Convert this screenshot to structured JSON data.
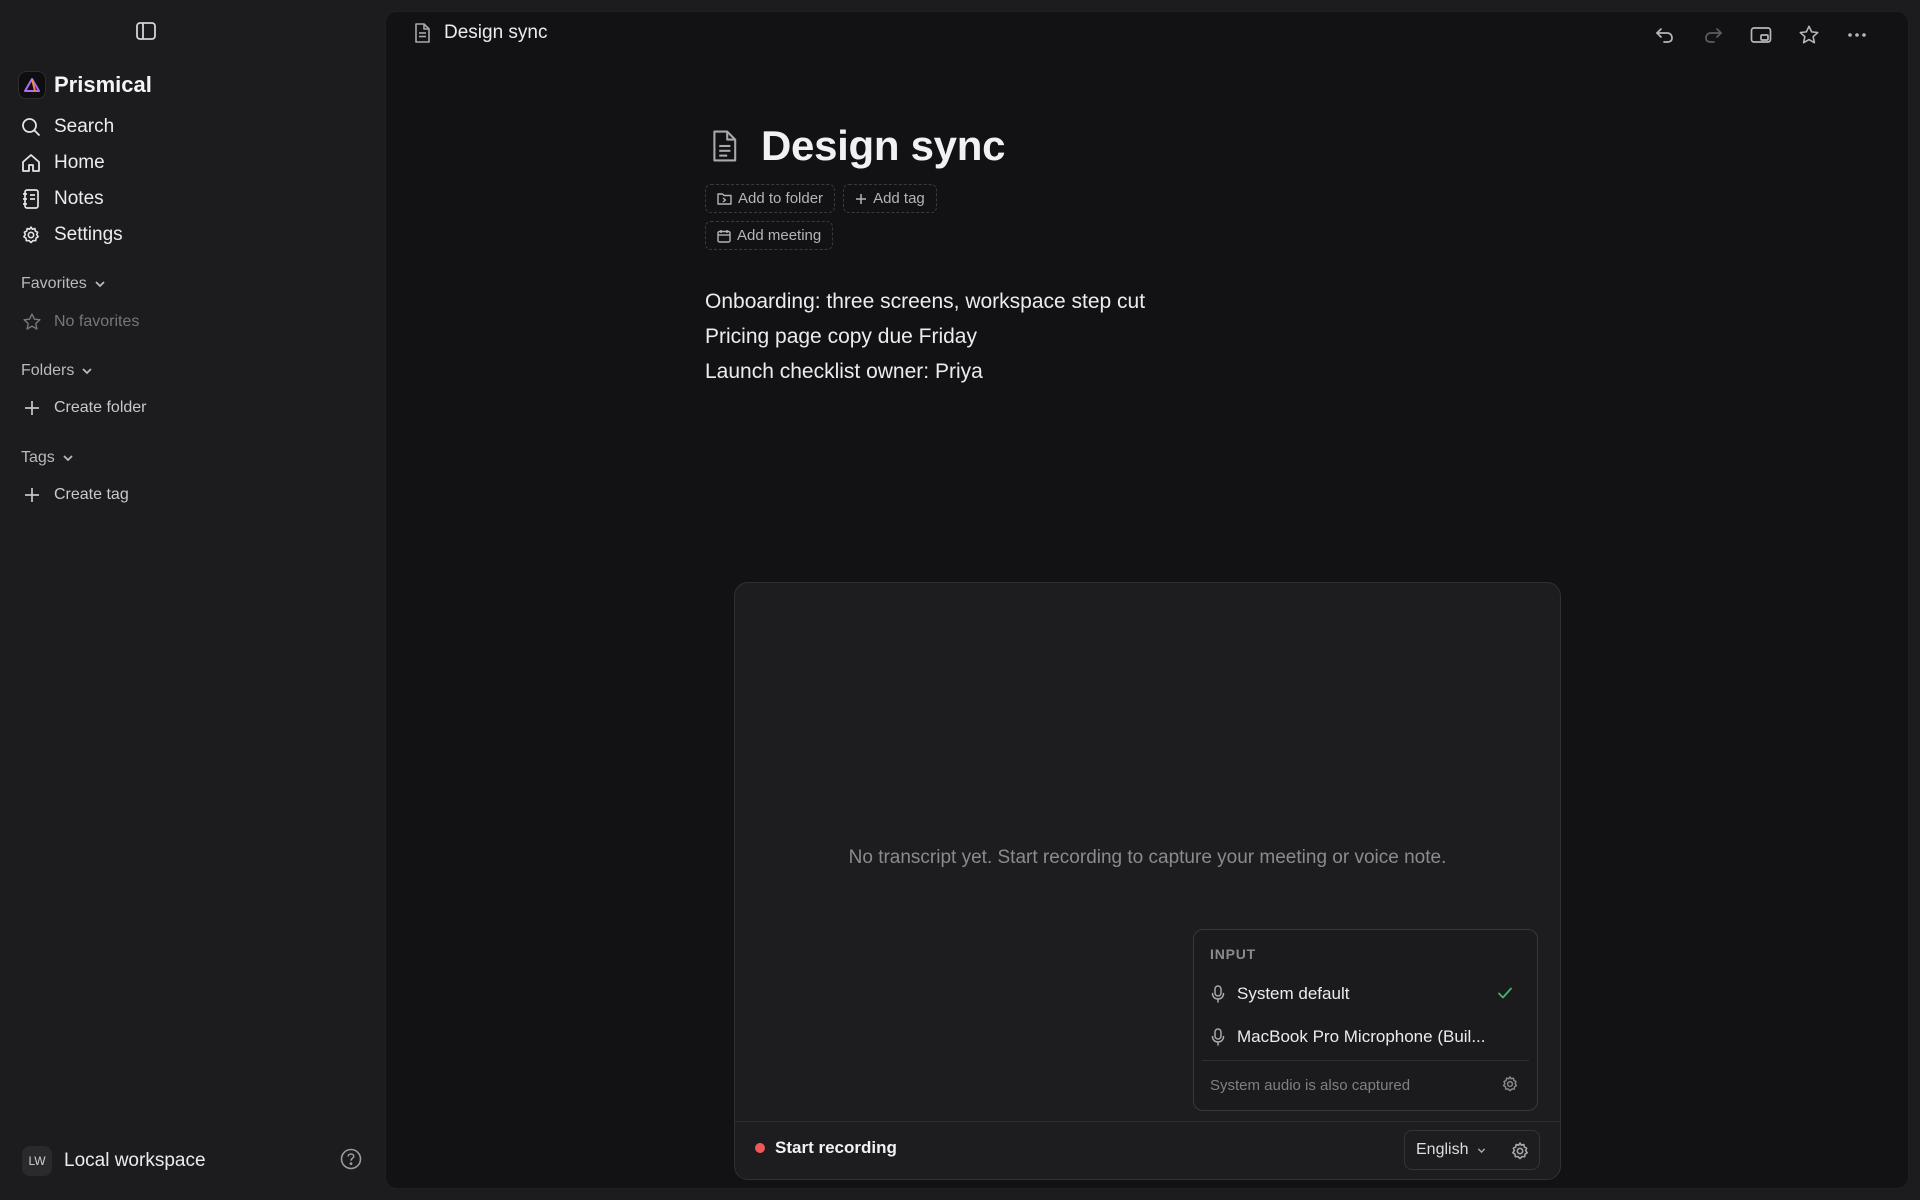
{
  "sidebar": {
    "toggle_icon": "sidebar-toggle-icon",
    "brand": {
      "name": "Prismical",
      "logo_icon": "prism-logo-icon",
      "logo_color": "#b06cf7"
    },
    "nav": [
      {
        "label": "Search",
        "icon": "search-icon"
      },
      {
        "label": "Home",
        "icon": "home-icon"
      },
      {
        "label": "Notes",
        "icon": "notes-icon"
      },
      {
        "label": "Settings",
        "icon": "gear-icon"
      }
    ],
    "favorites": {
      "label": "Favorites",
      "empty": "No favorites"
    },
    "folders": {
      "label": "Folders",
      "create": "Create folder"
    },
    "tags": {
      "label": "Tags",
      "create": "Create tag"
    },
    "workspace": {
      "initials": "LW",
      "name": "Local workspace"
    }
  },
  "topbar": {
    "title": "Design sync",
    "actions": [
      "undo-icon",
      "redo-icon",
      "present-icon",
      "star-icon",
      "more-icon"
    ]
  },
  "document": {
    "title": "Design sync",
    "chips": {
      "folder": "Add to folder",
      "tag": "Add tag",
      "meeting": "Add meeting"
    },
    "lines": [
      "Onboarding: three screens, workspace step cut",
      "Pricing page copy due Friday",
      "Launch checklist owner: Priya"
    ]
  },
  "transcript": {
    "empty": "No transcript yet. Start recording to capture your meeting or voice note.",
    "record_label": "Start recording",
    "record_color": "#f0575b",
    "language": "English",
    "input_menu": {
      "heading": "INPUT",
      "options": [
        {
          "label": "System default",
          "selected": true
        },
        {
          "label": "MacBook Pro Microphone (Buil...",
          "selected": false
        }
      ],
      "footer": "System audio is also captured",
      "check_color": "#4caf72"
    }
  }
}
